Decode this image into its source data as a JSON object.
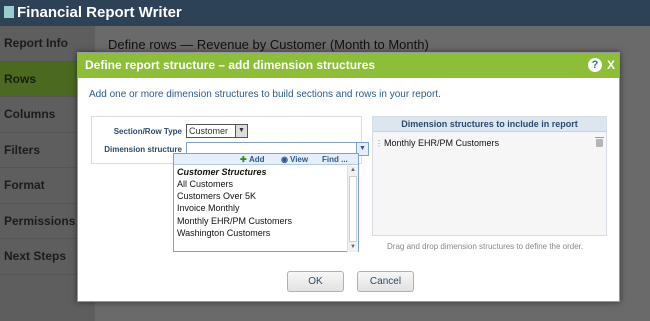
{
  "app": {
    "title": "Financial Report Writer",
    "nav": [
      {
        "label": "Report Info"
      },
      {
        "label": "Rows"
      },
      {
        "label": "Columns"
      },
      {
        "label": "Filters"
      },
      {
        "label": "Format"
      },
      {
        "label": "Permissions"
      },
      {
        "label": "Next Steps"
      }
    ],
    "active_nav": "Rows",
    "page_heading": "Define rows — Revenue by Customer (Month to Month)"
  },
  "modal": {
    "title": "Define report structure – add dimension structures",
    "help_glyph": "?",
    "close_glyph": "X",
    "intro": "Add one or more dimension structures to build sections and rows in your report.",
    "section_row_type_label": "Section/Row Type",
    "section_row_type_value": "Customer",
    "dimension_structure_label": "Dimension structure",
    "dimension_structure_value": "",
    "dropdown": {
      "toolbar": {
        "add": "Add",
        "view": "View",
        "find": "Find ..."
      },
      "group": "Customer Structures",
      "items": [
        "All Customers",
        "Customers Over 5K",
        "Invoice Monthly",
        "Monthly EHR/PM Customers",
        "Washington Customers"
      ]
    },
    "right_panel": {
      "header": "Dimension structures to include in report",
      "items": [
        "Monthly EHR/PM Customers"
      ],
      "note": "Drag and drop dimension structures to define the order."
    },
    "ok_label": "OK",
    "cancel_label": "Cancel"
  },
  "colors": {
    "header_bg": "#2d4257",
    "modal_titlebar": "#8cbe37",
    "accent_blue": "#2d5a8c"
  }
}
